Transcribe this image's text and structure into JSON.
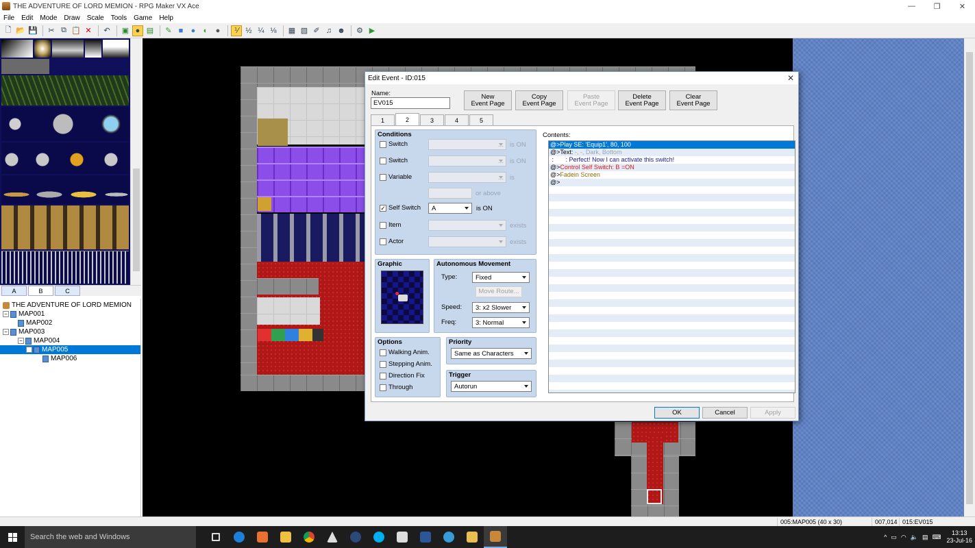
{
  "window": {
    "title": "THE ADVENTURE OF LORD MEMION - RPG Maker VX Ace"
  },
  "menu": [
    "File",
    "Edit",
    "Mode",
    "Draw",
    "Scale",
    "Tools",
    "Game",
    "Help"
  ],
  "palette_tabs": [
    "A",
    "B",
    "C"
  ],
  "tree": {
    "project": "THE ADVENTURE OF LORD MEMION",
    "maps": [
      {
        "label": "MAP001",
        "depth": 0,
        "expand": "−"
      },
      {
        "label": "MAP002",
        "depth": 1,
        "expand": ""
      },
      {
        "label": "MAP003",
        "depth": 0,
        "expand": "−"
      },
      {
        "label": "MAP004",
        "depth": 1,
        "expand": "−"
      },
      {
        "label": "MAP005",
        "depth": 2,
        "expand": "−",
        "selected": true
      },
      {
        "label": "MAP006",
        "depth": 3,
        "expand": ""
      }
    ]
  },
  "dialog": {
    "title": "Edit Event - ID:015",
    "name_label": "Name:",
    "name_value": "EV015",
    "buttons": {
      "new_l1": "New",
      "new_l2": "Event Page",
      "copy_l1": "Copy",
      "copy_l2": "Event Page",
      "paste_l1": "Paste",
      "paste_l2": "Event Page",
      "delete_l1": "Delete",
      "delete_l2": "Event Page",
      "clear_l1": "Clear",
      "clear_l2": "Event Page"
    },
    "tabs": [
      "1",
      "2",
      "3",
      "4",
      "5"
    ],
    "conditions": {
      "title": "Conditions",
      "switch1": "Switch",
      "switch1_suffix": "is ON",
      "switch2": "Switch",
      "switch2_suffix": "is ON",
      "variable": "Variable",
      "variable_suffix": "is",
      "or_above": "or above",
      "self_switch": "Self Switch",
      "self_switch_value": "A",
      "self_switch_suffix": "is ON",
      "item": "Item",
      "item_suffix": "exists",
      "actor": "Actor",
      "actor_suffix": "exists",
      "ellipsis": "..."
    },
    "graphic": {
      "title": "Graphic"
    },
    "movement": {
      "title": "Autonomous Movement",
      "type_label": "Type:",
      "type_value": "Fixed",
      "move_route": "Move Route...",
      "speed_label": "Speed:",
      "speed_value": "3: x2 Slower",
      "freq_label": "Freq:",
      "freq_value": "3: Normal"
    },
    "options": {
      "title": "Options",
      "walking": "Walking Anim.",
      "stepping": "Stepping Anim.",
      "direction_fix": "Direction Fix",
      "through": "Through"
    },
    "priority": {
      "title": "Priority",
      "value": "Same as Characters"
    },
    "trigger": {
      "title": "Trigger",
      "value": "Autorun"
    },
    "contents": {
      "label": "Contents:",
      "lines": [
        {
          "prefix": "@>",
          "text": "Play SE: 'Equip1', 80, 100",
          "style": "sel"
        },
        {
          "prefix": "@>",
          "text": "Text: ",
          "extra": "-, -, Dark, Bottom",
          "style": "text"
        },
        {
          "prefix": " :       ",
          "text": ": Perfect! Now I can activate this switch!",
          "style": "blue"
        },
        {
          "prefix": "@>",
          "text": "Control Self Switch: B =ON",
          "style": "red"
        },
        {
          "prefix": "@>",
          "text": "Fadein Screen",
          "style": "olive"
        },
        {
          "prefix": "@>",
          "text": "",
          "style": "plain"
        }
      ]
    },
    "footer": {
      "ok": "OK",
      "cancel": "Cancel",
      "apply": "Apply"
    }
  },
  "status": {
    "map": "005:MAP005 (40 x 30)",
    "coords": "007,014",
    "event": "015:EV015"
  },
  "taskbar": {
    "search": "Search the web and Windows",
    "time": "13:13",
    "date": "23-Jul-16"
  },
  "colors": {
    "selection": "#0078d7",
    "group": "#c8d8ec",
    "map_bg": "#5f82c6"
  }
}
